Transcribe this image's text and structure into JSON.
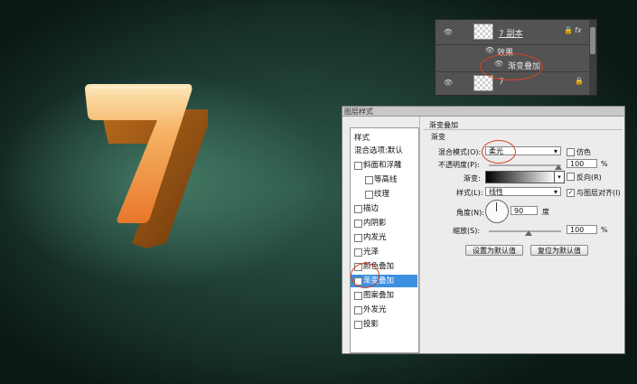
{
  "layers_panel": {
    "layer_copy_name": "7 副本",
    "effects_label": "效果",
    "effect_item": "渐变叠加",
    "layer_name": "7"
  },
  "dialog": {
    "title": "图层样式",
    "style_list": [
      {
        "label": "样式",
        "checkbox": false,
        "checked": false,
        "selected": false
      },
      {
        "label": "混合选项:默认",
        "checkbox": false,
        "checked": false,
        "selected": false
      },
      {
        "label": "斜面和浮雕",
        "checkbox": true,
        "checked": false,
        "selected": false
      },
      {
        "label": "等高线",
        "checkbox": true,
        "checked": false,
        "selected": false
      },
      {
        "label": "纹理",
        "checkbox": true,
        "checked": false,
        "selected": false
      },
      {
        "label": "描边",
        "checkbox": true,
        "checked": false,
        "selected": false
      },
      {
        "label": "内阴影",
        "checkbox": true,
        "checked": false,
        "selected": false
      },
      {
        "label": "内发光",
        "checkbox": true,
        "checked": false,
        "selected": false
      },
      {
        "label": "光泽",
        "checkbox": true,
        "checked": false,
        "selected": false
      },
      {
        "label": "颜色叠加",
        "checkbox": true,
        "checked": false,
        "selected": false
      },
      {
        "label": "渐变叠加",
        "checkbox": true,
        "checked": true,
        "selected": true
      },
      {
        "label": "图案叠加",
        "checkbox": true,
        "checked": false,
        "selected": false
      },
      {
        "label": "外发光",
        "checkbox": true,
        "checked": false,
        "selected": false
      },
      {
        "label": "投影",
        "checkbox": true,
        "checked": false,
        "selected": false
      }
    ],
    "section_title": "渐变叠加",
    "group_title": "渐变",
    "blend_mode_label": "混合模式(O):",
    "blend_mode_value": "柔光",
    "dither_label": "仿色",
    "opacity_label": "不透明度(P):",
    "opacity_value": "100",
    "opacity_unit": "%",
    "gradient_label": "渐变:",
    "reverse_label": "反向(R)",
    "style_label": "样式(L):",
    "style_value": "线性",
    "align_label": "与图层对齐(I)",
    "angle_label": "角度(N):",
    "angle_value": "90",
    "angle_unit": "度",
    "scale_label": "缩放(S):",
    "scale_value": "100",
    "scale_unit": "%",
    "set_default_button": "设置为默认值",
    "reset_default_button": "复位为默认值"
  },
  "artwork": {
    "numeral": "7"
  },
  "colors": {
    "annotation_ring": "#d9421e",
    "selection": "#3d8fe0"
  }
}
